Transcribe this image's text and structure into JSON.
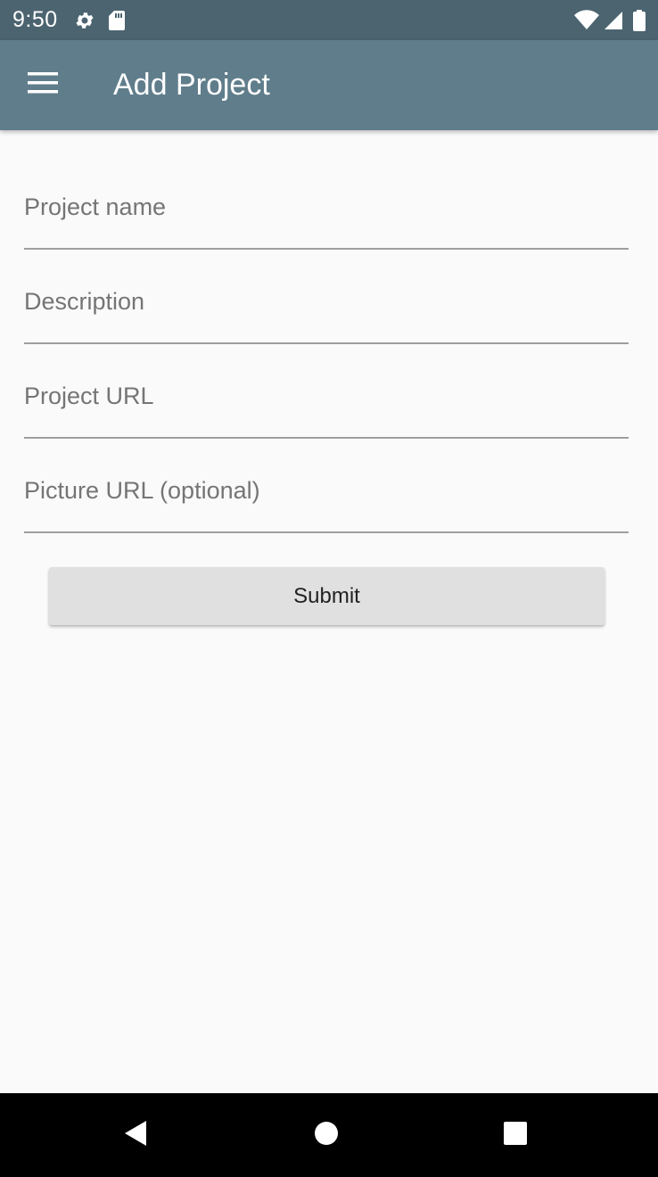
{
  "status_bar": {
    "time": "9:50",
    "icons": [
      "settings-icon",
      "sd-card-icon",
      "wifi-icon",
      "cell-signal-icon",
      "battery-icon"
    ]
  },
  "app_bar": {
    "title": "Add Project",
    "menu_icon": "hamburger-menu-icon",
    "color": "#607d8b"
  },
  "form": {
    "fields": [
      {
        "placeholder": "Project name",
        "value": ""
      },
      {
        "placeholder": "Description",
        "value": ""
      },
      {
        "placeholder": "Project URL",
        "value": ""
      },
      {
        "placeholder": "Picture URL (optional)",
        "value": ""
      }
    ],
    "submit_label": "Submit"
  },
  "nav_bar": {
    "icons": [
      "back-icon",
      "home-icon",
      "recents-icon"
    ]
  }
}
